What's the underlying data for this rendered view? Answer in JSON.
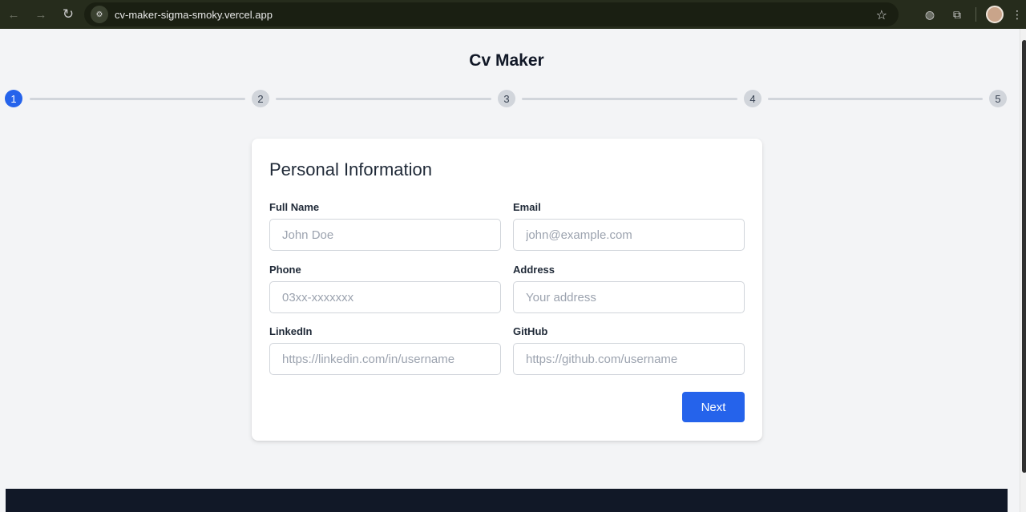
{
  "browser": {
    "url": "cv-maker-sigma-smoky.vercel.app",
    "back_icon": "←",
    "forward_icon": "→",
    "reload_icon": "↻",
    "star_icon": "☆"
  },
  "app": {
    "title": "Cv Maker"
  },
  "stepper": {
    "steps": [
      "1",
      "2",
      "3",
      "4",
      "5"
    ],
    "active_step": 1,
    "accent": "#2563eb"
  },
  "form": {
    "title": "Personal Information",
    "fields": [
      {
        "label": "Full Name",
        "placeholder": "John Doe",
        "value": ""
      },
      {
        "label": "Email",
        "placeholder": "john@example.com",
        "value": ""
      },
      {
        "label": "Phone",
        "placeholder": "03xx-xxxxxxx",
        "value": ""
      },
      {
        "label": "Address",
        "placeholder": "Your address",
        "value": ""
      },
      {
        "label": "LinkedIn",
        "placeholder": "https://linkedin.com/in/username",
        "value": ""
      },
      {
        "label": "GitHub",
        "placeholder": "https://github.com/username",
        "value": ""
      }
    ],
    "next_label": "Next"
  },
  "colors": {
    "primary": "#2563eb",
    "footer": "#111827",
    "background": "#f3f4f6"
  }
}
